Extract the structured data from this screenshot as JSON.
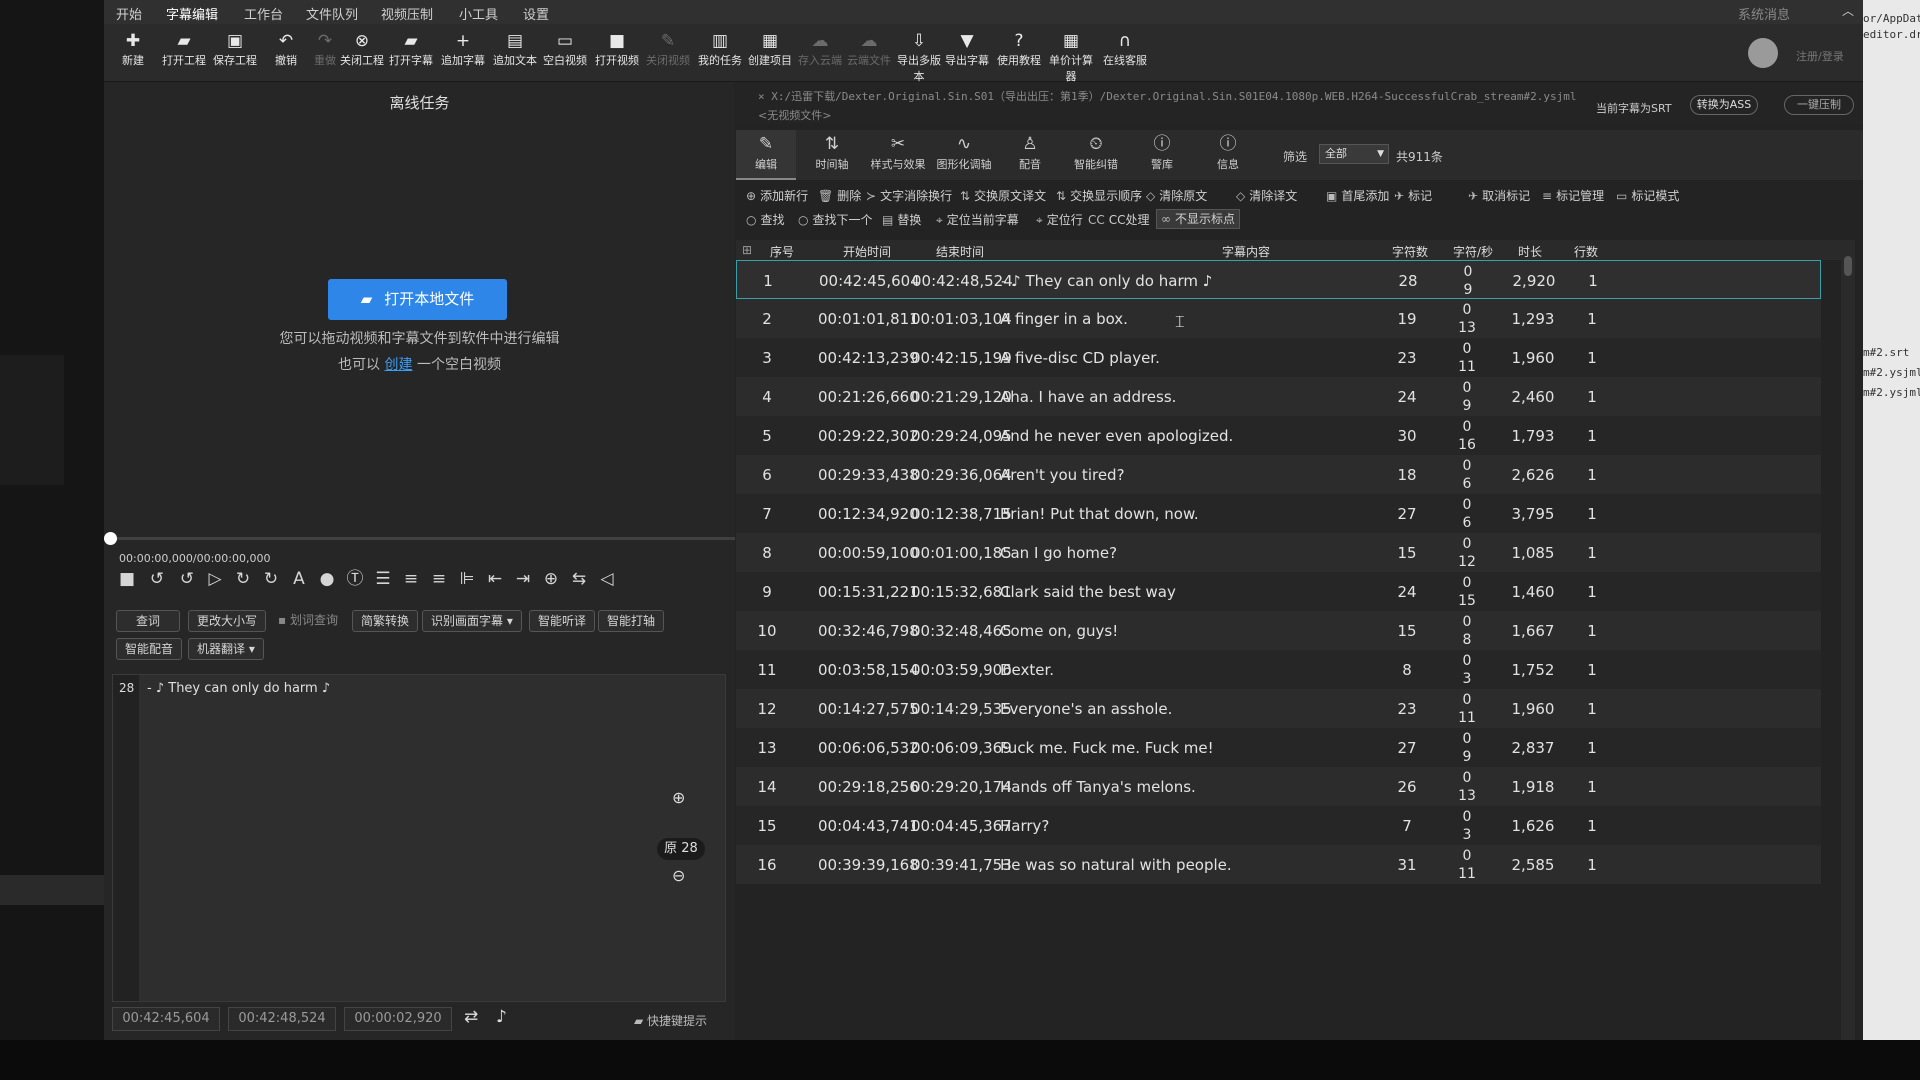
{
  "menu": [
    "开始",
    "字幕编辑",
    "工作台",
    "文件队列",
    "视频压制",
    "小工具",
    "设置"
  ],
  "menu_active": "字幕编辑",
  "system_message": "系统消息",
  "toolbar": [
    {
      "label": "新建",
      "icon": "new-icon",
      "glyph": "✚"
    },
    {
      "label": "打开工程",
      "icon": "folder-open-icon",
      "glyph": "▰"
    },
    {
      "label": "保存工程",
      "icon": "save-icon",
      "glyph": "▣"
    },
    {
      "label": "撤销",
      "icon": "undo-icon",
      "glyph": "↶"
    },
    {
      "label": "重做",
      "icon": "redo-icon",
      "glyph": "↷"
    },
    {
      "label": "关闭工程",
      "icon": "close-project-icon",
      "glyph": "⊗"
    },
    {
      "label": "打开字幕",
      "icon": "open-subtitle-icon",
      "glyph": "▰"
    },
    {
      "label": "追加字幕",
      "icon": "append-subtitle-icon",
      "glyph": "+"
    },
    {
      "label": "追加文本",
      "icon": "append-text-icon",
      "glyph": "▤"
    },
    {
      "label": "空白视频",
      "icon": "blank-video-icon",
      "glyph": "▭"
    },
    {
      "label": "打开视频",
      "icon": "open-video-icon",
      "glyph": "■"
    },
    {
      "label": "关闭视频",
      "icon": "close-video-icon",
      "glyph": "✎"
    },
    {
      "label": "我的任务",
      "icon": "tasks-icon",
      "glyph": "▥"
    },
    {
      "label": "创建项目",
      "icon": "create-project-icon",
      "glyph": "▦"
    },
    {
      "label": "存入云端",
      "icon": "cloud-save-icon",
      "glyph": "☁"
    },
    {
      "label": "云端文件",
      "icon": "cloud-files-icon",
      "glyph": "☁"
    },
    {
      "label": "导出多版本",
      "icon": "export-multi-icon",
      "glyph": "⇩"
    },
    {
      "label": "导出字幕",
      "icon": "export-subtitle-icon",
      "glyph": "▼"
    },
    {
      "label": "使用教程",
      "icon": "help-icon",
      "glyph": "?"
    },
    {
      "label": "单价计算器",
      "icon": "calculator-icon",
      "glyph": "▦"
    },
    {
      "label": "在线客服",
      "icon": "headset-icon",
      "glyph": "∩"
    }
  ],
  "login_label": "注册/登录",
  "left": {
    "title": "离线任务",
    "open_button": "打开本地文件",
    "hint_line1": "您可以拖动视频和字幕文件到软件中进行编辑",
    "hint_pre": "也可以",
    "hint_link": "创建",
    "hint_post": "一个空白视频",
    "time_readout": "00:00:00,000/00:00:00,000",
    "buttons_row1": [
      "查词",
      "更改大小写",
      "划词查询",
      "简繁转换",
      "识别画面字幕 ▾",
      "智能听译",
      "智能打轴"
    ],
    "buttons_row2": [
      "智能配音",
      "机器翻译 ▾"
    ],
    "editor_line_no": "28",
    "editor_text": "- ♪ They can only do harm ♪",
    "orig_count": "原 28",
    "start_box": "00:42:45,604",
    "end_box": "00:42:48,524",
    "dur_box": "00:00:02,920",
    "shortcut_hint": "快捷键提示"
  },
  "right": {
    "path": "× X:/迅雷下载/Dexter.Original.Sin.S01（导出出压：第1季）/Dexter.Original.Sin.S01E04.1080p.WEB.H264-SuccessfulCrab_stream#2.ysjml",
    "no_video": "<无视频文件>",
    "srt_label": "当前字幕为SRT",
    "to_ass": "转换为ASS",
    "one_compress": "一键压制",
    "tabs": [
      {
        "label": "编辑",
        "icon": "edit-icon",
        "glyph": "✎"
      },
      {
        "label": "时间轴",
        "icon": "timeline-icon",
        "glyph": "⇅"
      },
      {
        "label": "样式与效果",
        "icon": "style-icon",
        "glyph": "✂"
      },
      {
        "label": "图形化调轴",
        "icon": "graph-icon",
        "glyph": "∿"
      },
      {
        "label": "配音",
        "icon": "mic-icon",
        "glyph": "♙"
      },
      {
        "label": "智能纠错",
        "icon": "smart-fix-icon",
        "glyph": "⏲"
      },
      {
        "label": "警库",
        "icon": "warning-lib-icon",
        "glyph": "ⓘ"
      },
      {
        "label": "信息",
        "icon": "info-icon",
        "glyph": "ⓘ"
      }
    ],
    "filter_label": "筛选",
    "filter_value": "全部",
    "count_label": "共911条",
    "actions_row1": [
      {
        "label": "添加新行",
        "glyph": "⊕"
      },
      {
        "label": "删除",
        "glyph": "🗑"
      },
      {
        "label": "文字消除换行",
        "glyph": "≻"
      },
      {
        "label": "交换原文译文",
        "glyph": "⇅"
      },
      {
        "label": "交换显示顺序",
        "glyph": "⇅"
      },
      {
        "label": "清除原文",
        "glyph": "◇"
      },
      {
        "label": "清除译文",
        "glyph": "◇"
      },
      {
        "label": "首尾添加",
        "glyph": "▣"
      },
      {
        "label": "标记",
        "glyph": "✈"
      },
      {
        "label": "取消标记",
        "glyph": "✈"
      },
      {
        "label": "标记管理",
        "glyph": "≡"
      },
      {
        "label": "标记模式",
        "glyph": "▭"
      }
    ],
    "actions_row2": [
      {
        "label": "查找",
        "glyph": "○"
      },
      {
        "label": "查找下一个",
        "glyph": "○"
      },
      {
        "label": "替换",
        "glyph": "▤"
      },
      {
        "label": "定位当前字幕",
        "glyph": "⌖"
      },
      {
        "label": "定位行",
        "glyph": "⌖"
      },
      {
        "label": "CC处理",
        "glyph": "CC"
      },
      {
        "label": "不显示标点",
        "glyph": "∞"
      }
    ],
    "columns": [
      "序号",
      "开始时间",
      "结束时间",
      "字幕内容",
      "字符数",
      "字符/秒",
      "时长",
      "行数"
    ],
    "rows": [
      {
        "n": "1",
        "start": "00:42:45,604",
        "end": "00:42:48,524",
        "text": "- ♪ They can only do harm ♪",
        "chars": "28",
        "cps_a": "0",
        "cps_b": "9",
        "dur": "2,920",
        "lines": "1"
      },
      {
        "n": "2",
        "start": "00:01:01,811",
        "end": "00:01:03,104",
        "text": "A finger in a box.",
        "chars": "19",
        "cps_a": "0",
        "cps_b": "13",
        "dur": "1,293",
        "lines": "1"
      },
      {
        "n": "3",
        "start": "00:42:13,239",
        "end": "00:42:15,199",
        "text": "A five-disc CD player.",
        "chars": "23",
        "cps_a": "0",
        "cps_b": "11",
        "dur": "1,960",
        "lines": "1"
      },
      {
        "n": "4",
        "start": "00:21:26,660",
        "end": "00:21:29,120",
        "text": "Aha. I have an address.",
        "chars": "24",
        "cps_a": "0",
        "cps_b": "9",
        "dur": "2,460",
        "lines": "1"
      },
      {
        "n": "5",
        "start": "00:29:22,302",
        "end": "00:29:24,095",
        "text": "And he never even apologized.",
        "chars": "30",
        "cps_a": "0",
        "cps_b": "16",
        "dur": "1,793",
        "lines": "1"
      },
      {
        "n": "6",
        "start": "00:29:33,438",
        "end": "00:29:36,064",
        "text": "Aren't you tired?",
        "chars": "18",
        "cps_a": "0",
        "cps_b": "6",
        "dur": "2,626",
        "lines": "1"
      },
      {
        "n": "7",
        "start": "00:12:34,920",
        "end": "00:12:38,715",
        "text": "Brian! Put that down, now.",
        "chars": "27",
        "cps_a": "0",
        "cps_b": "6",
        "dur": "3,795",
        "lines": "1"
      },
      {
        "n": "8",
        "start": "00:00:59,100",
        "end": "00:01:00,185",
        "text": "Can I go home?",
        "chars": "15",
        "cps_a": "0",
        "cps_b": "12",
        "dur": "1,085",
        "lines": "1"
      },
      {
        "n": "9",
        "start": "00:15:31,221",
        "end": "00:15:32,681",
        "text": "Clark said the best way",
        "chars": "24",
        "cps_a": "0",
        "cps_b": "15",
        "dur": "1,460",
        "lines": "1"
      },
      {
        "n": "10",
        "start": "00:32:46,798",
        "end": "00:32:48,465",
        "text": "Come on, guys!",
        "chars": "15",
        "cps_a": "0",
        "cps_b": "8",
        "dur": "1,667",
        "lines": "1"
      },
      {
        "n": "11",
        "start": "00:03:58,154",
        "end": "00:03:59,906",
        "text": "Dexter.",
        "chars": "8",
        "cps_a": "0",
        "cps_b": "3",
        "dur": "1,752",
        "lines": "1"
      },
      {
        "n": "12",
        "start": "00:14:27,575",
        "end": "00:14:29,535",
        "text": "Everyone's an asshole.",
        "chars": "23",
        "cps_a": "0",
        "cps_b": "11",
        "dur": "1,960",
        "lines": "1"
      },
      {
        "n": "13",
        "start": "00:06:06,532",
        "end": "00:06:09,369",
        "text": "Fuck me. Fuck me. Fuck me!",
        "chars": "27",
        "cps_a": "0",
        "cps_b": "9",
        "dur": "2,837",
        "lines": "1"
      },
      {
        "n": "14",
        "start": "00:29:18,256",
        "end": "00:29:20,174",
        "text": "Hands off Tanya's melons.",
        "chars": "26",
        "cps_a": "0",
        "cps_b": "13",
        "dur": "1,918",
        "lines": "1"
      },
      {
        "n": "15",
        "start": "00:04:43,741",
        "end": "00:04:45,367",
        "text": "Harry?",
        "chars": "7",
        "cps_a": "0",
        "cps_b": "3",
        "dur": "1,626",
        "lines": "1"
      },
      {
        "n": "16",
        "start": "00:39:39,168",
        "end": "00:39:41,753",
        "text": "He was so natural with people.",
        "chars": "31",
        "cps_a": "0",
        "cps_b": "11",
        "dur": "2,585",
        "lines": "1"
      }
    ]
  },
  "desktop_right": [
    "or/AppDat",
    "editor.draf",
    "m#2.srt",
    "m#2.ysjml",
    "m#2.ysjml"
  ]
}
